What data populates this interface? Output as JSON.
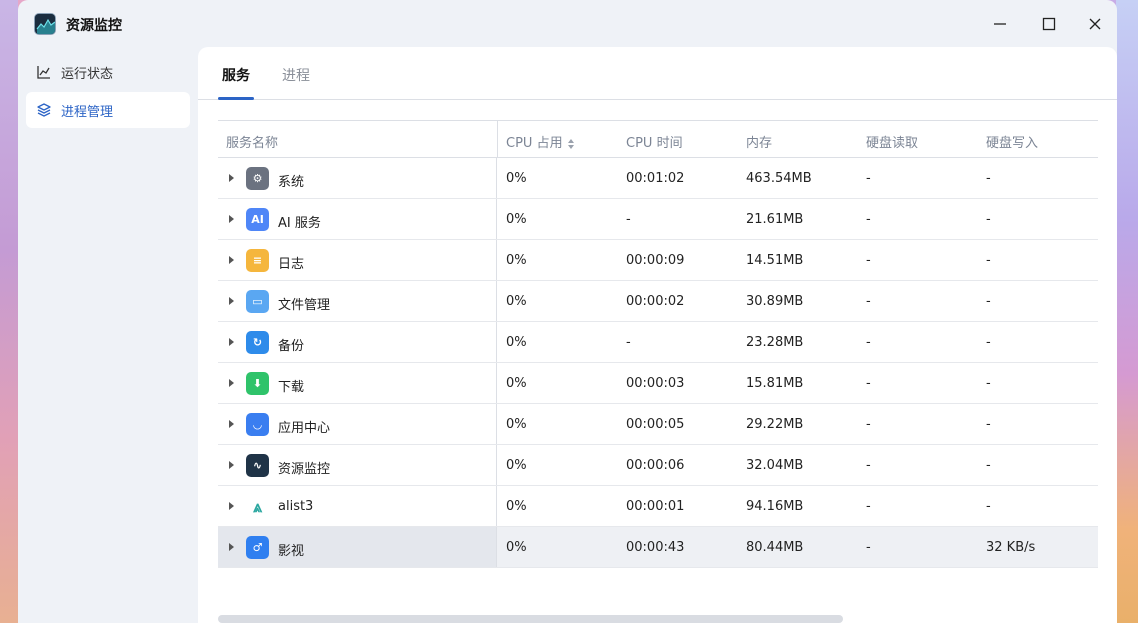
{
  "window": {
    "title": "资源监控"
  },
  "sidebar": {
    "items": [
      {
        "label": "运行状态",
        "icon": "chart-line-icon",
        "active": false
      },
      {
        "label": "进程管理",
        "icon": "layers-icon",
        "active": true
      }
    ]
  },
  "tabs": [
    {
      "label": "服务",
      "active": true
    },
    {
      "label": "进程",
      "active": false
    }
  ],
  "table": {
    "headers": [
      "服务名称",
      "CPU 占用",
      "CPU 时间",
      "内存",
      "硬盘读取",
      "硬盘写入"
    ],
    "rows": [
      {
        "name": "系统",
        "icon": "gear-icon",
        "color": "#6b7280",
        "glyph": "⚙",
        "cpu": "0%",
        "time": "00:01:02",
        "mem": "463.54MB",
        "read": "-",
        "write": "-"
      },
      {
        "name": "AI 服务",
        "icon": "ai-icon",
        "color": "#4f86f7",
        "glyph": "AI",
        "cpu": "0%",
        "time": "-",
        "mem": "21.61MB",
        "read": "-",
        "write": "-"
      },
      {
        "name": "日志",
        "icon": "log-icon",
        "color": "#f5b63d",
        "glyph": "≡",
        "cpu": "0%",
        "time": "00:00:09",
        "mem": "14.51MB",
        "read": "-",
        "write": "-"
      },
      {
        "name": "文件管理",
        "icon": "folder-icon",
        "color": "#5aa7f2",
        "glyph": "▭",
        "cpu": "0%",
        "time": "00:00:02",
        "mem": "30.89MB",
        "read": "-",
        "write": "-"
      },
      {
        "name": "备份",
        "icon": "backup-icon",
        "color": "#2e8bea",
        "glyph": "↻",
        "cpu": "0%",
        "time": "-",
        "mem": "23.28MB",
        "read": "-",
        "write": "-"
      },
      {
        "name": "下载",
        "icon": "download-icon",
        "color": "#2fc36a",
        "glyph": "⬇",
        "cpu": "0%",
        "time": "00:00:03",
        "mem": "15.81MB",
        "read": "-",
        "write": "-"
      },
      {
        "name": "应用中心",
        "icon": "app-store-icon",
        "color": "#3a7ef0",
        "glyph": "◡",
        "cpu": "0%",
        "time": "00:00:05",
        "mem": "29.22MB",
        "read": "-",
        "write": "-"
      },
      {
        "name": "资源监控",
        "icon": "monitor-icon",
        "color": "#1f3347",
        "glyph": "∿",
        "cpu": "0%",
        "time": "00:00:06",
        "mem": "32.04MB",
        "read": "-",
        "write": "-"
      },
      {
        "name": "alist3",
        "icon": "alist-icon",
        "color": "#ffffff",
        "glyph": "⩓",
        "cpu": "0%",
        "time": "00:00:01",
        "mem": "94.16MB",
        "read": "-",
        "write": "-"
      },
      {
        "name": "影视",
        "icon": "video-icon",
        "color": "#2f7ff0",
        "glyph": "♂",
        "cpu": "0%",
        "time": "00:00:43",
        "mem": "80.44MB",
        "read": "-",
        "write": "32 KB/s",
        "highlighted": true
      }
    ]
  },
  "colors": {
    "accent": "#2c64c6",
    "header_text": "#7c8595"
  }
}
